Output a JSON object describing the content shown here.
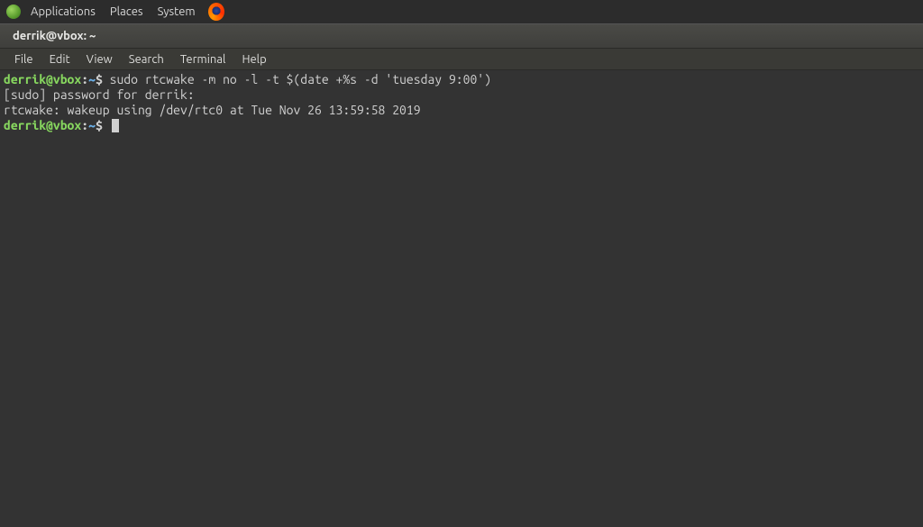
{
  "top_panel": {
    "applications": "Applications",
    "places": "Places",
    "system": "System"
  },
  "window": {
    "title": "derrik@vbox: ~"
  },
  "menubar": {
    "file": "File",
    "edit": "Edit",
    "view": "View",
    "search": "Search",
    "terminal": "Terminal",
    "help": "Help"
  },
  "terminal": {
    "line1_prompt_userhost": "derrik@vbox",
    "line1_prompt_sep1": ":",
    "line1_prompt_path": "~",
    "line1_prompt_dollar": "$ ",
    "line1_cmd": "sudo rtcwake -m no -l -t $(date +%s -d 'tuesday 9:00')",
    "line2": "[sudo] password for derrik:",
    "line3": "rtcwake: wakeup using /dev/rtc0 at Tue Nov 26 13:59:58 2019",
    "line4_prompt_userhost": "derrik@vbox",
    "line4_prompt_sep1": ":",
    "line4_prompt_path": "~",
    "line4_prompt_dollar": "$ "
  }
}
